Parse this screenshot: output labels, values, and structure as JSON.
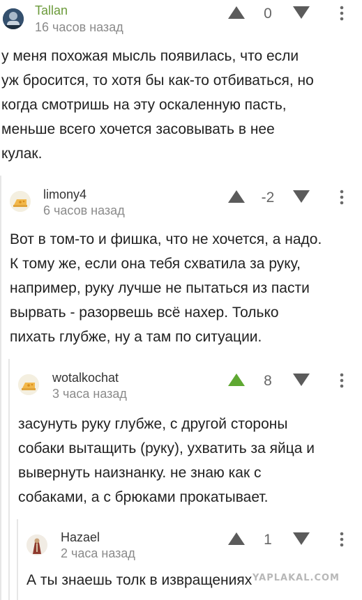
{
  "comments": [
    {
      "author": "Tallan",
      "time": "16 часов назад",
      "rating": "0",
      "avatar_icon": "user-avatar-icon",
      "body": [
        "у меня похожая мысль появилась, что если",
        "уж бросится, то хотя бы как-то отбиваться, но",
        "когда смотришь на эту оскаленную пасть,",
        "меньше всего хочется засовывать в нее",
        "кулак."
      ]
    },
    {
      "author": "limony4",
      "time": "6 часов назад",
      "rating": "-2",
      "avatar_icon": "cheese-avatar-icon",
      "body": [
        "Вот в том-то и фишка, что не хочется, а надо.",
        "К тому же, если она тебя схватила за руку,",
        "например, руку лучше не пытаться из пасти",
        "вырвать - разорвешь всё нахер. Только",
        "пихать глубже, ну а там по ситуации."
      ]
    },
    {
      "author": "wotalkochat",
      "time": "3 часа назад",
      "rating": "8",
      "upvoted": true,
      "avatar_icon": "cheese-avatar-icon",
      "body": [
        "засунуть руку глубже, с другой стороны",
        "собаки вытащить (руку), ухватить за яйца и",
        "вывернуть наизнанку. не знаю как с",
        "собаками, а с брюками прокатывает."
      ]
    },
    {
      "author": "Hazael",
      "time": "2 часа назад",
      "rating": "1",
      "avatar_icon": "user-avatar-icon",
      "body": [
        "А ты знаешь толк в извращениях"
      ]
    }
  ],
  "watermark": "YAPLAKAL.COM",
  "colors": {
    "upvote_active": "#5fa832",
    "vote_inactive": "#5b5b5b",
    "thread_line": "#e6e6e6",
    "author_green": "#6b9a3a"
  }
}
